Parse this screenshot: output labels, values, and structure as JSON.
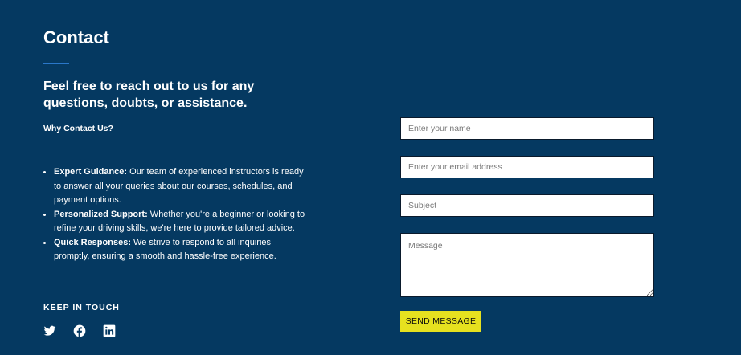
{
  "contact": {
    "title": "Contact",
    "tagline": "Feel free to reach out to us for any questions, doubts, or assistance.",
    "why_heading": "Why Contact Us?",
    "reasons": [
      {
        "label": "Expert Guidance:",
        "text": " Our team of experienced instructors is ready to answer all your queries about our courses, schedules, and payment options."
      },
      {
        "label": "Personalized Support:",
        "text": " Whether you're a beginner or looking to refine your driving skills, we're here to provide tailored advice."
      },
      {
        "label": "Quick Responses:",
        "text": " We strive to respond to all inquiries promptly, ensuring a smooth and hassle-free experience."
      }
    ],
    "keep_in_touch": "KEEP IN TOUCH",
    "socials": [
      "twitter-icon",
      "facebook-icon",
      "linkedin-icon"
    ]
  },
  "form": {
    "name_placeholder": "Enter your name",
    "email_placeholder": "Enter your email address",
    "subject_placeholder": "Subject",
    "message_placeholder": "Message",
    "name_value": "",
    "email_value": "",
    "subject_value": "",
    "message_value": "",
    "send_label": "SEND MESSAGE"
  },
  "colors": {
    "background": "#053961",
    "accent_button": "#e6e11f",
    "underline": "#2a77c9",
    "text": "#ffffff"
  }
}
